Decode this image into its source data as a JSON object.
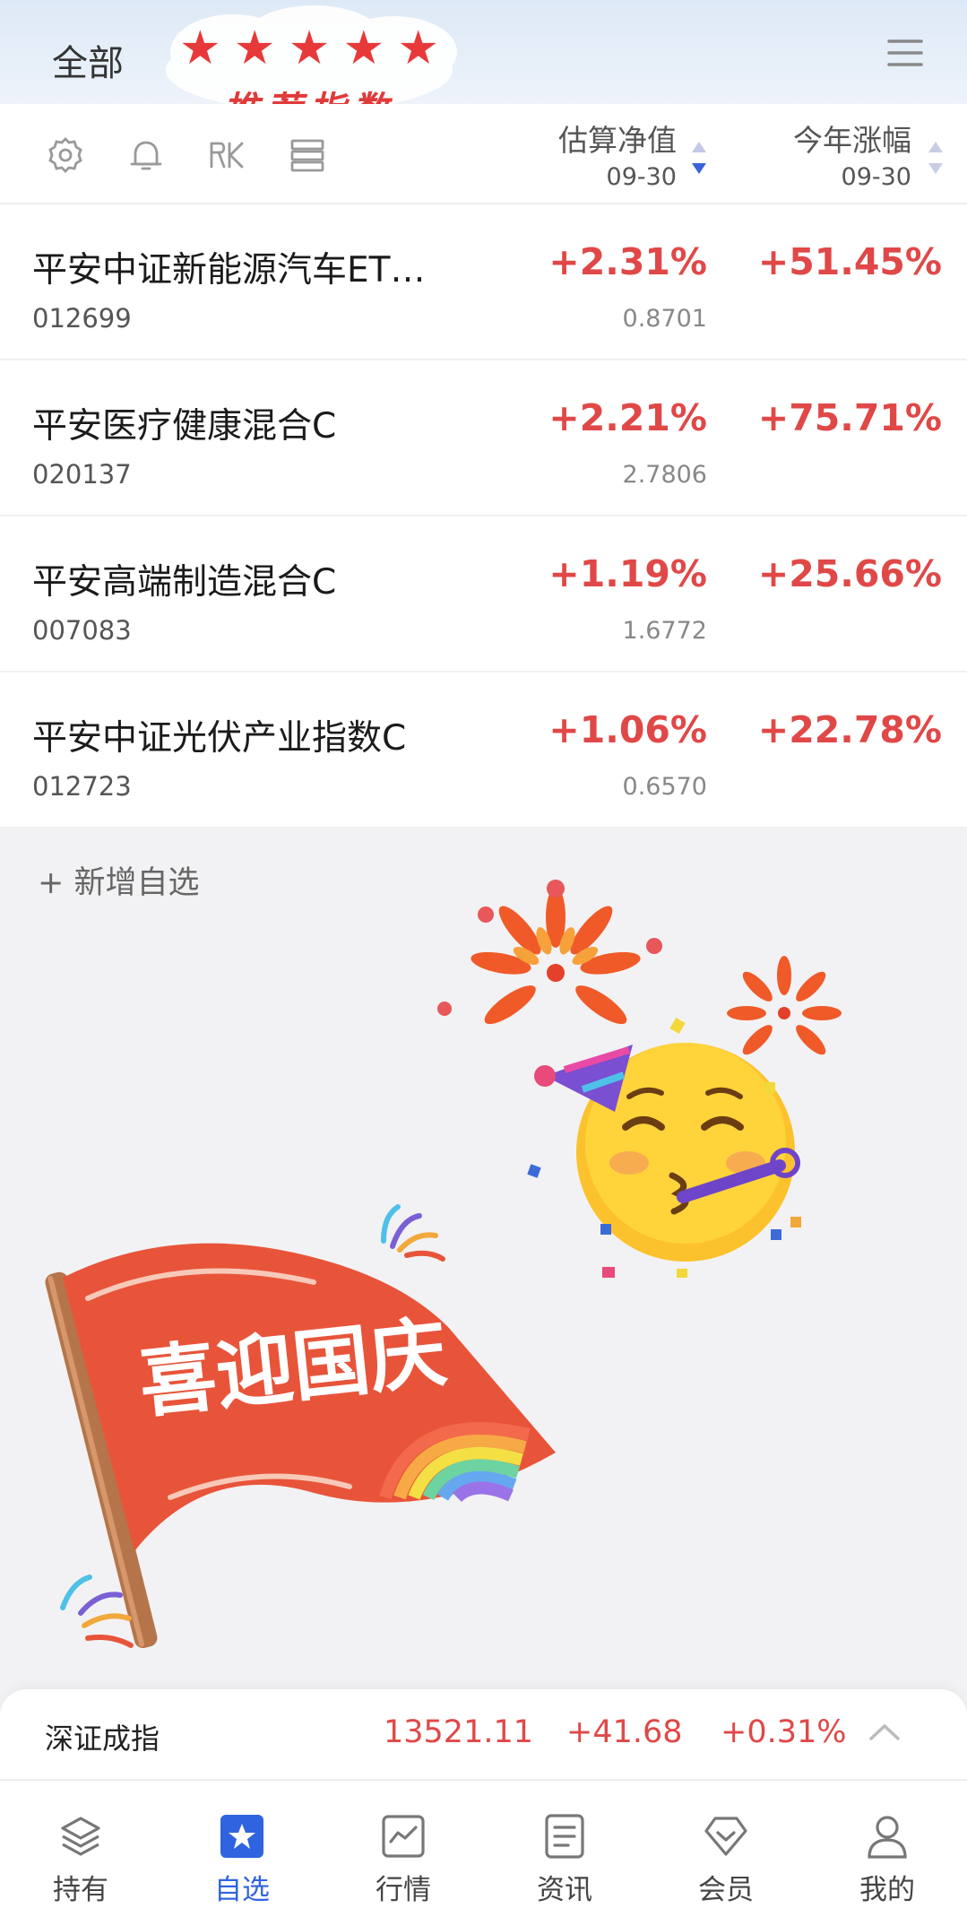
{
  "header": {
    "group_title": "全部",
    "promo": {
      "stars": [
        "★",
        "★",
        "★",
        "★",
        "★"
      ],
      "text": "推荐指数"
    },
    "menu_icon": "hamburger-menu-icon"
  },
  "toolbar": {
    "icons": [
      "settings-icon",
      "bell-icon",
      "candlestick-k-icon",
      "list-layout-icon"
    ],
    "columns": [
      {
        "label": "估算净值",
        "date": "09-30"
      },
      {
        "label": "今年涨幅",
        "date": "09-30"
      }
    ]
  },
  "funds": [
    {
      "name": "平安中证新能源汽车ET…",
      "code": "012699",
      "est_change": "+2.31%",
      "nav": "0.8701",
      "ytd": "+51.45%"
    },
    {
      "name": "平安医疗健康混合C",
      "code": "020137",
      "est_change": "+2.21%",
      "nav": "2.7806",
      "ytd": "+75.71%"
    },
    {
      "name": "平安高端制造混合C",
      "code": "007083",
      "est_change": "+1.19%",
      "nav": "1.6772",
      "ytd": "+25.66%"
    },
    {
      "name": "平安中证光伏产业指数C",
      "code": "012723",
      "est_change": "+1.06%",
      "nav": "0.6570",
      "ytd": "+22.78%"
    }
  ],
  "add_watchlist": "+ 新增自选",
  "decoration": {
    "banner_text": "喜迎国庆"
  },
  "ticker": {
    "name": "深证成指",
    "value": "13521.11",
    "change": "+41.68",
    "change_pct": "+0.31%"
  },
  "bottom_nav": [
    {
      "label": "持有",
      "icon": "layers-icon",
      "active": false
    },
    {
      "label": "自选",
      "icon": "star-icon",
      "active": true
    },
    {
      "label": "行情",
      "icon": "chart-icon",
      "active": false
    },
    {
      "label": "资讯",
      "icon": "document-icon",
      "active": false
    },
    {
      "label": "会员",
      "icon": "diamond-icon",
      "active": false
    },
    {
      "label": "我的",
      "icon": "user-icon",
      "active": false
    }
  ],
  "colors": {
    "up": "#e04848",
    "accent": "#2f63e0",
    "promo_red": "#e03a3a"
  }
}
